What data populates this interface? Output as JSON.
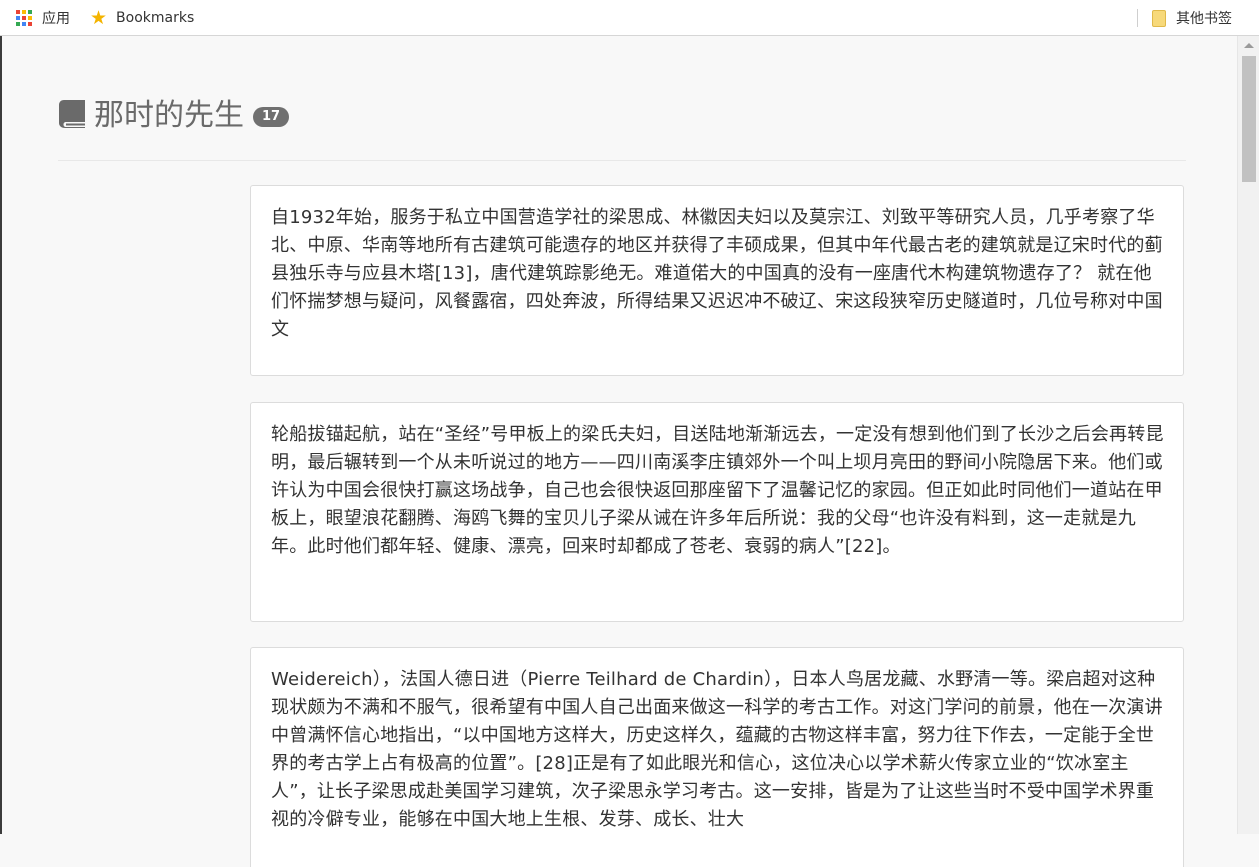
{
  "bookmarks_bar": {
    "apps_label": "应用",
    "bookmarks_label": "Bookmarks",
    "other_bookmarks_label": "其他书签",
    "apps_icon_colors": [
      "#ea4335",
      "#fbbc05",
      "#34a853",
      "#4285f4",
      "#ea4335",
      "#fbbc05",
      "#34a853",
      "#4285f4",
      "#ea4335"
    ]
  },
  "header": {
    "title": "那时的先生",
    "count": "17",
    "icon": "book-icon"
  },
  "cards": [
    {
      "text": "自1932年始，服务于私立中国营造学社的梁思成、林徽因夫妇以及莫宗江、刘致平等研究人员，几乎考察了华北、中原、华南等地所有古建筑可能遗存的地区并获得了丰硕成果，但其中年代最古老的建筑就是辽宋时代的蓟县独乐寺与应县木塔[13]，唐代建筑踪影绝无。难道偌大的中国真的没有一座唐代木构建筑物遗存了？ 就在他们怀揣梦想与疑问，风餐露宿，四处奔波，所得结果又迟迟冲不破辽、宋这段狭窄历史隧道时，几位号称对中国文"
    },
    {
      "text": "轮船拔锚起航，站在“圣经”号甲板上的梁氏夫妇，目送陆地渐渐远去，一定没有想到他们到了长沙之后会再转昆明，最后辗转到一个从未听说过的地方——四川南溪李庄镇郊外一个叫上坝月亮田的野间小院隐居下来。他们或许认为中国会很快打赢这场战争，自己也会很快返回那座留下了温馨记忆的家园。但正如此时同他们一道站在甲板上，眼望浪花翻腾、海鸥飞舞的宝贝儿子梁从诫在许多年后所说：我的父母“也许没有料到，这一走就是九年。此时他们都年轻、健康、漂亮，回来时却都成了苍老、衰弱的病人”[22]。"
    },
    {
      "text": "Weidereich），法国人德日进（Pierre Teilhard de Chardin），日本人鸟居龙藏、水野清一等。梁启超对这种现状颇为不满和不服气，很希望有中国人自己出面来做这一科学的考古工作。对这门学问的前景，他在一次演讲中曾满怀信心地指出，“以中国地方这样大，历史这样久，蕴藏的古物这样丰富，努力往下作去，一定能于全世界的考古学上占有极高的位置”。[28]正是有了如此眼光和信心，这位决心以学术薪火传家立业的“饮冰室主人”，让长子梁思成赴美国学习建筑，次子梁思永学习考古。这一安排，皆是为了让这些当时不受中国学术界重视的冷僻专业，能够在中国大地上生根、发芽、成长、壮大"
    }
  ]
}
